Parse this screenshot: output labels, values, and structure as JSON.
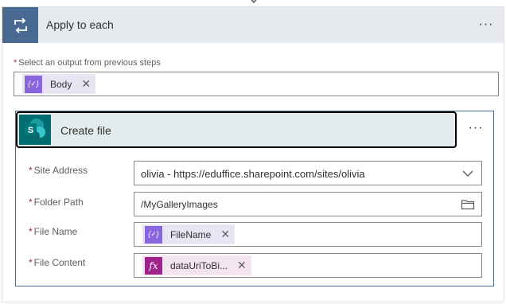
{
  "apply_to_each": {
    "title": "Apply to each",
    "menu": "···",
    "select_label": "Select an output from previous steps",
    "required_mark": "*",
    "token": {
      "label": "Body",
      "icon": "dynamic-content-icon",
      "close": "✕"
    }
  },
  "create_file": {
    "title": "Create file",
    "menu": "···",
    "icon": "sharepoint-icon",
    "icon_letter": "S",
    "fields": {
      "site_address": {
        "label": "Site Address",
        "value": "olivia - https://eduffice.sharepoint.com/sites/olivia"
      },
      "folder_path": {
        "label": "Folder Path",
        "value": "/MyGalleryImages"
      },
      "file_name": {
        "label": "File Name",
        "token": "FileName",
        "close": "✕"
      },
      "file_content": {
        "label": "File Content",
        "token": "dataUriToBi...",
        "close": "✕",
        "fx": "fx"
      }
    }
  },
  "colors": {
    "loop_header": "#486991",
    "sharepoint": "#036c70",
    "dynamic_token": "#8966e0",
    "expression_token": "#a0228c",
    "required": "#a4262c"
  }
}
